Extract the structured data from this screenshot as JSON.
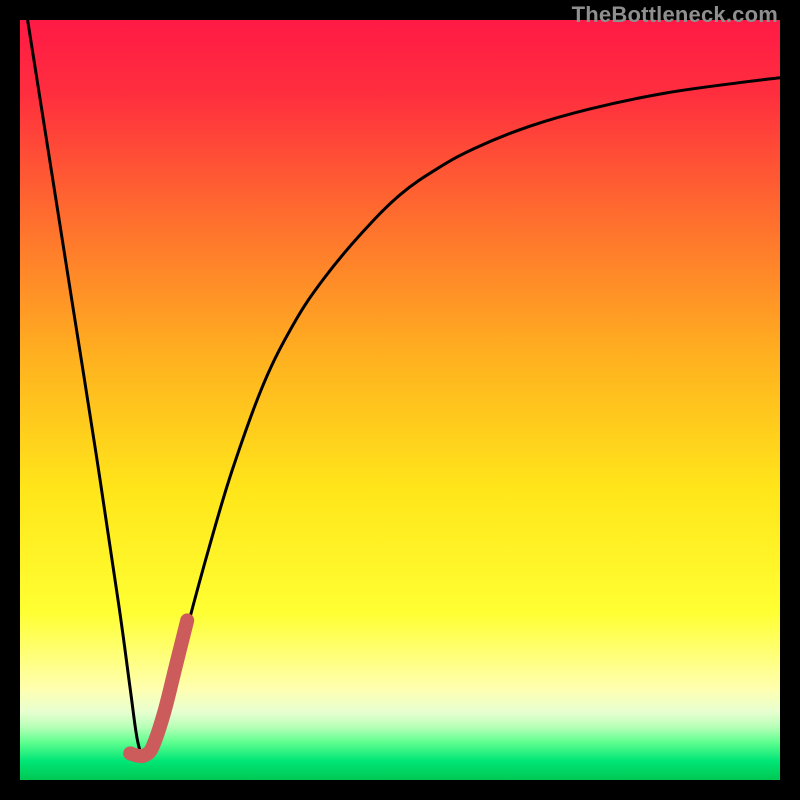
{
  "watermark": "TheBottleneck.com",
  "chart_data": {
    "type": "line",
    "title": "",
    "xlabel": "",
    "ylabel": "",
    "xlim": [
      0,
      100
    ],
    "ylim": [
      0,
      100
    ],
    "grid": false,
    "legend": false,
    "gradient_stops": [
      {
        "offset": 0.0,
        "color": "#ff1a45"
      },
      {
        "offset": 0.1,
        "color": "#ff2f3e"
      },
      {
        "offset": 0.25,
        "color": "#ff6a2f"
      },
      {
        "offset": 0.45,
        "color": "#ffb31f"
      },
      {
        "offset": 0.62,
        "color": "#ffe61a"
      },
      {
        "offset": 0.78,
        "color": "#ffff33"
      },
      {
        "offset": 0.88,
        "color": "#ffffb0"
      },
      {
        "offset": 0.91,
        "color": "#e8ffd0"
      },
      {
        "offset": 0.93,
        "color": "#b8ffb8"
      },
      {
        "offset": 0.95,
        "color": "#60ff90"
      },
      {
        "offset": 0.975,
        "color": "#00e676"
      },
      {
        "offset": 1.0,
        "color": "#00c853"
      }
    ],
    "series": [
      {
        "name": "curve-black",
        "stroke": "#000000",
        "stroke_width": 3,
        "x": [
          1,
          4,
          7,
          10,
          13,
          14.5,
          15.5,
          16.5,
          18,
          20,
          22,
          25,
          28,
          32,
          36,
          40,
          45,
          50,
          55,
          60,
          67,
          75,
          85,
          95,
          100
        ],
        "y": [
          100,
          81,
          62,
          43,
          23,
          12,
          5,
          3,
          5,
          12,
          20,
          31,
          41,
          52,
          60,
          66,
          72,
          77,
          80.5,
          83.2,
          86,
          88.3,
          90.4,
          91.8,
          92.4
        ]
      },
      {
        "name": "curve-red-marker",
        "stroke": "#cc5c5c",
        "stroke_width": 14,
        "linecap": "round",
        "x": [
          14.5,
          15.5,
          16.5,
          17.5,
          19,
          20.5,
          22
        ],
        "y": [
          3.5,
          3.2,
          3.3,
          4.5,
          9,
          15,
          21
        ]
      }
    ]
  }
}
